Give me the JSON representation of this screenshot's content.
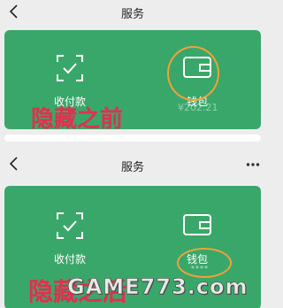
{
  "top_screen": {
    "header": {
      "title": "服务"
    },
    "card": {
      "actions": [
        {
          "label": "收付款",
          "icon": "scan-pay-icon"
        },
        {
          "label": "钱包",
          "icon": "wallet-icon"
        }
      ],
      "wallet_balance": "¥202.21"
    },
    "annotation": "隐藏之前"
  },
  "bottom_screen": {
    "header": {
      "title": "服务"
    },
    "card": {
      "actions": [
        {
          "label": "收付款",
          "icon": "scan-pay-icon"
        },
        {
          "label": "钱包",
          "icon": "wallet-icon"
        }
      ],
      "wallet_balance_masked": "****"
    },
    "annotation": "隐藏之后",
    "watermark": "GAME773.com"
  },
  "colors": {
    "card_green": "#3aa76a",
    "annotation_red": "#e0304f",
    "circle_orange": "#f0a23a",
    "background": "#ededed"
  }
}
